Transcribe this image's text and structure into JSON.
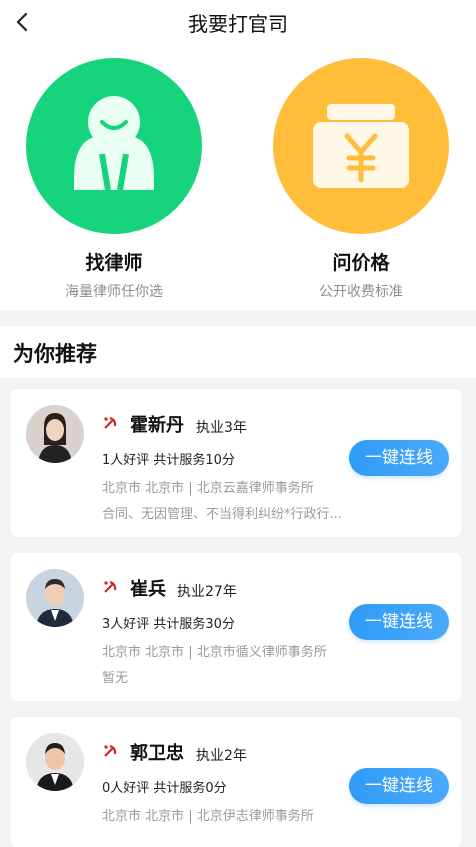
{
  "header": {
    "title": "我要打官司"
  },
  "hero": {
    "left": {
      "title": "找律师",
      "subtitle": "海量律师任你选"
    },
    "right": {
      "title": "问价格",
      "subtitle": "公开收费标准"
    }
  },
  "section": {
    "title": "为你推荐"
  },
  "lawyers": [
    {
      "name": "霍新丹",
      "years": "执业3年",
      "stats": "1人好评  共计服务10分",
      "address": "北京市  北京市 | 北京云嘉律师事务所",
      "tags": "合同、无因管理、不当得利纠纷*行政行...",
      "button": "一键连线"
    },
    {
      "name": "崔兵",
      "years": "执业27年",
      "stats": "3人好评  共计服务30分",
      "address": "北京市  北京市 | 北京市循义律师事务所",
      "tags": "暂无",
      "button": "一键连线"
    },
    {
      "name": "郭卫忠",
      "years": "执业2年",
      "stats": "0人好评  共计服务0分",
      "address": "北京市  北京市 | 北京伊志律师事务所",
      "tags": "",
      "button": "一键连线"
    }
  ],
  "colors": {
    "accent": "#2f9bf6",
    "green": "#16d47c",
    "yellow": "#ffbd3a",
    "party_red": "#d91f1f"
  }
}
